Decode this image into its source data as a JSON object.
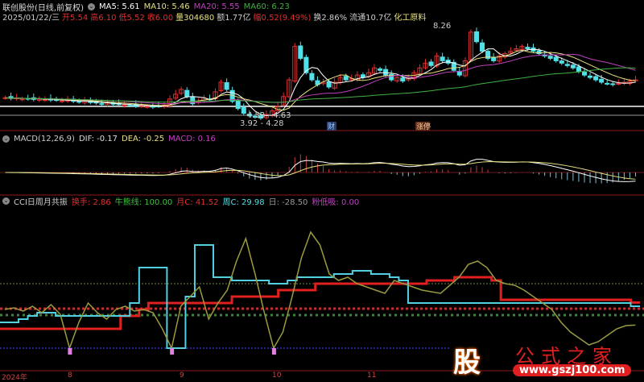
{
  "header": {
    "name": "联创股份(日线,前复权)",
    "ma5": "MA5: 5.61",
    "ma10": "MA10: 5.46",
    "ma20": "MA20: 5.55",
    "ma60": "MA60: 6.23",
    "date": "2025/01/22/三",
    "open": "开5.54",
    "high": "高6.10",
    "low": "低5.52",
    "close": "收6.00",
    "vol": "量304680",
    "amount": "额1.77亿",
    "change": "幅0.52(9.49%)",
    "turnover": "换2.86%",
    "float": "流通10.7亿",
    "sector": "化工原料"
  },
  "annotations": {
    "high": "8.26",
    "range1": "4.53 - 4.63",
    "range2": "3.92 - 4.28",
    "cai": "财",
    "zhang": "涨停"
  },
  "macd": {
    "title": "MACD(12,26,9)",
    "dif": "DIF: -0.17",
    "dea": "DEA: -0.25",
    "macd": "MACD: 0.16"
  },
  "cci": {
    "title": "CCI日周月共振",
    "turn": "换手: 2.86",
    "bull": "牛熊线: 100.00",
    "month": "月C: 41.52",
    "week": "周C: 29.98",
    "day": "日: -28.50",
    "pink": "粉低吸: 0.00"
  },
  "xaxis": [
    "2024年",
    "8",
    "9",
    "10",
    "11"
  ],
  "watermark": {
    "logo": "股",
    "name": "公式之家",
    "url": "www.gszj100.com"
  },
  "colors": {
    "up": "#e03030",
    "down": "#50e0e8",
    "ma5": "#ffffff",
    "ma10": "#e8e080",
    "ma20": "#c040c0",
    "ma60": "#40b040"
  },
  "chart_data": {
    "type": "candlestick",
    "closes": [
      5.25,
      5.22,
      5.24,
      5.2,
      5.21,
      5.18,
      5.2,
      5.17,
      5.15,
      5.16,
      5.12,
      5.14,
      5.1,
      5.08,
      5.1,
      5.05,
      5.03,
      5.0,
      5.02,
      4.98,
      4.96,
      4.95,
      4.93,
      4.9,
      4.92,
      4.88,
      4.86,
      4.9,
      4.95,
      5.2,
      5.4,
      5.6,
      5.3,
      5.0,
      5.1,
      5.25,
      5.2,
      5.5,
      5.9,
      5.6,
      5.1,
      4.8,
      4.6,
      4.5,
      4.45,
      4.4,
      4.55,
      4.7,
      4.9,
      5.3,
      6.0,
      7.4,
      6.9,
      6.3,
      6.0,
      5.8,
      5.9,
      5.7,
      5.9,
      6.1,
      6.0,
      6.05,
      6.2,
      6.1,
      6.3,
      6.5,
      6.4,
      6.2,
      6.0,
      6.1,
      5.95,
      6.05,
      6.3,
      6.5,
      6.7,
      6.6,
      7.0,
      6.8,
      6.7,
      6.4,
      6.2,
      6.8,
      8.0,
      7.6,
      7.2,
      6.9,
      6.8,
      7.0,
      7.1,
      7.2,
      7.3,
      7.4,
      7.3,
      7.2,
      7.1,
      7.0,
      6.9,
      6.8,
      6.7,
      6.6,
      6.5,
      6.35,
      6.2,
      6.1,
      6.0,
      5.9,
      5.85,
      5.8,
      5.85,
      5.9,
      5.95,
      6.0
    ],
    "cci_day": [
      20,
      25,
      15,
      30,
      10,
      35,
      5,
      -100,
      -20,
      40,
      10,
      -10,
      20,
      30,
      15,
      20,
      10,
      -40,
      -100,
      30,
      60,
      90,
      -10,
      40,
      80,
      170,
      240,
      130,
      10,
      -100,
      -50,
      60,
      180,
      260,
      220,
      130,
      110,
      120,
      100,
      90,
      80,
      70,
      110,
      100,
      90,
      80,
      75,
      70,
      95,
      120,
      160,
      170,
      150,
      110,
      100,
      95,
      80,
      60,
      40,
      20,
      -20,
      -50,
      -70,
      -90,
      -80,
      -60,
      -40,
      -30,
      -28.5
    ],
    "cci_week": [
      -20,
      -20,
      -10,
      0,
      10,
      10,
      0,
      0,
      0,
      0,
      0,
      0,
      0,
      0,
      40,
      150,
      150,
      150,
      -100,
      -100,
      60,
      220,
      220,
      120,
      120,
      110,
      110,
      110,
      110,
      100,
      100,
      110,
      120,
      120,
      120,
      120,
      130,
      130,
      140,
      140,
      130,
      130,
      120,
      110,
      40,
      40,
      40,
      40,
      40,
      40,
      40,
      40,
      40,
      40,
      40,
      40,
      40,
      40,
      40,
      40,
      40,
      40,
      40,
      40,
      40,
      40,
      40,
      40,
      30
    ],
    "cci_month": [
      -40,
      -40,
      -40,
      -40,
      -40,
      -40,
      -40,
      -40,
      -40,
      -40,
      -40,
      -40,
      -40,
      0,
      0,
      20,
      40,
      40,
      40,
      40,
      40,
      40,
      40,
      40,
      40,
      60,
      60,
      60,
      60,
      60,
      80,
      80,
      80,
      80,
      100,
      100,
      100,
      100,
      100,
      100,
      100,
      100,
      100,
      100,
      100,
      100,
      110,
      110,
      110,
      120,
      120,
      120,
      120,
      110,
      50,
      50,
      50,
      50,
      50,
      50,
      50,
      50,
      50,
      50,
      50,
      50,
      50,
      50,
      41.5
    ]
  }
}
